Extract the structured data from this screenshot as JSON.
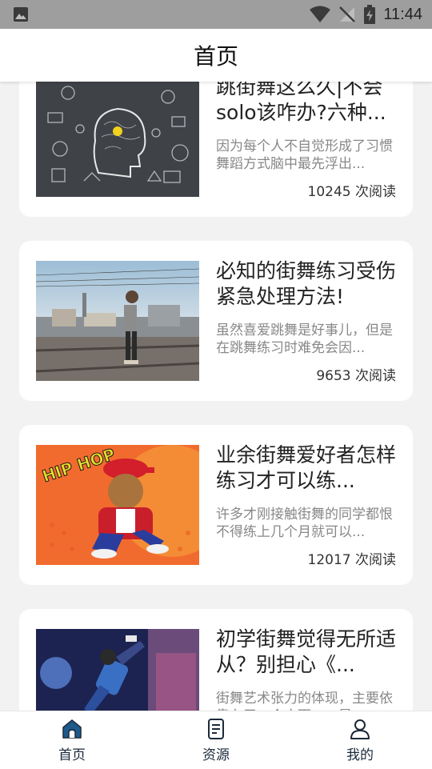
{
  "status_bar": {
    "time": "11:44",
    "left_icon": "image-icon",
    "right_icons": [
      "wifi-icon",
      "no-signal-icon",
      "battery-charging-icon"
    ]
  },
  "header": {
    "title": "首页"
  },
  "articles": [
    {
      "title": "跳街舞这么久|不会solo该咋办?六种...",
      "summary": "因为每个人不自觉形成了习惯舞蹈方式脑中最先浮出...",
      "reads": "10245 次阅读",
      "image": "head-idea-sketch"
    },
    {
      "title": "必知的街舞练习受伤紧急处理方法!",
      "summary": "虽然喜爱跳舞是好事儿，但是在跳舞练习时难免会因...",
      "reads": "9653 次阅读",
      "image": "dancer-on-railway"
    },
    {
      "title": "业余街舞爱好者怎样练习才可以练...",
      "summary": "许多才刚接触街舞的同学都恨不得练上几个月就可以...",
      "reads": "12017 次阅读",
      "image": "hiphop-cartoon"
    },
    {
      "title": "初学街舞觉得无所适从？别担心《...",
      "summary": "街舞艺术张力的体现，主要依靠在于一个方面，一是...",
      "reads": "",
      "image": "breakdancer-graffiti"
    }
  ],
  "bottom_nav": [
    {
      "label": "首页",
      "icon": "home-icon",
      "active": true
    },
    {
      "label": "资源",
      "icon": "document-icon",
      "active": false
    },
    {
      "label": "我的",
      "icon": "user-icon",
      "active": false
    }
  ],
  "colors": {
    "accent": "#1e5a8a",
    "nav_text": "#1b2a3a",
    "status_bar": "#9e9e9e"
  }
}
